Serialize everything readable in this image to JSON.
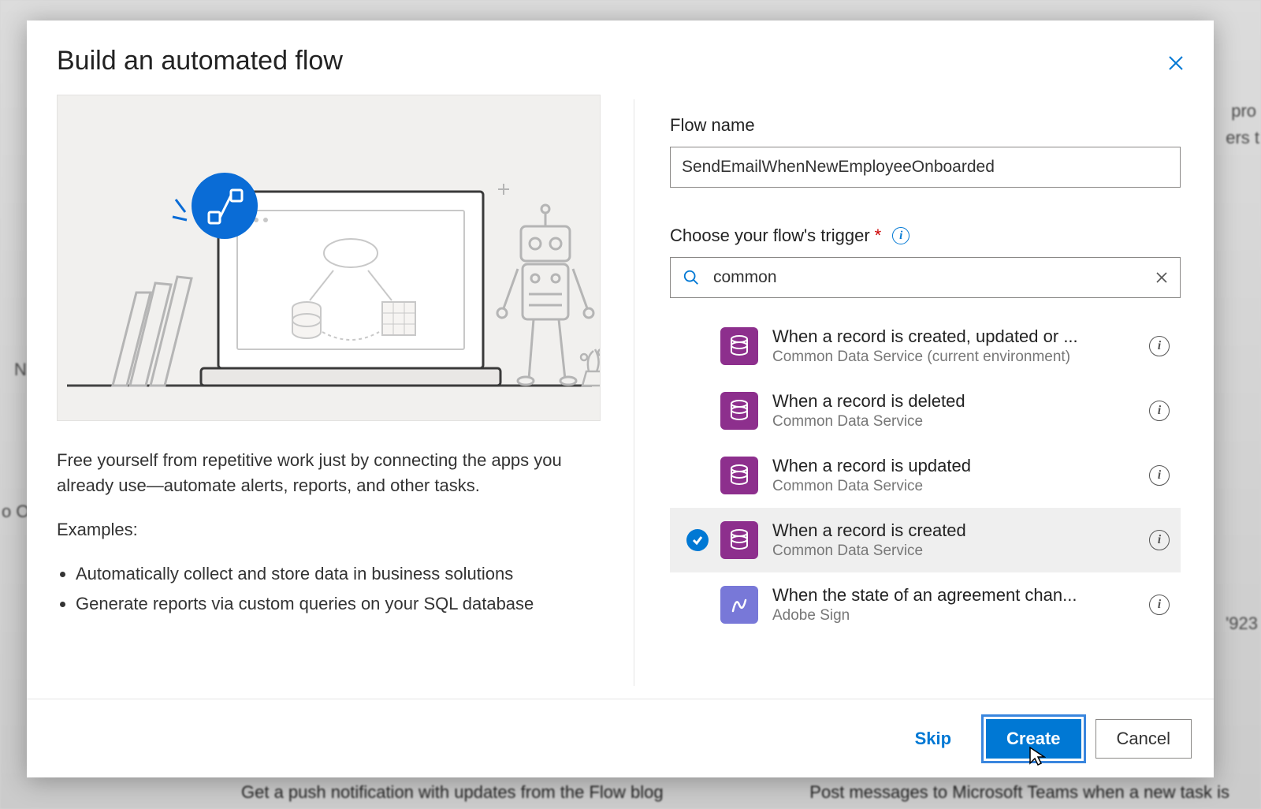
{
  "dialog": {
    "title": "Build an automated flow",
    "close_label": "Close"
  },
  "left": {
    "description": "Free yourself from repetitive work just by connecting the apps you already use—automate alerts, reports, and other tasks.",
    "examples_heading": "Examples:",
    "examples": [
      "Automatically collect and store data in business solutions",
      "Generate reports via custom queries on your SQL database"
    ]
  },
  "right": {
    "flow_name_label": "Flow name",
    "flow_name_value": "SendEmailWhenNewEmployeeOnboarded",
    "trigger_label": "Choose your flow's trigger",
    "search_value": "common",
    "triggers": [
      {
        "title": "When a record is created, updated or ...",
        "sub": "Common Data Service (current environment)",
        "connector": "cds",
        "selected": false
      },
      {
        "title": "When a record is deleted",
        "sub": "Common Data Service",
        "connector": "cds",
        "selected": false
      },
      {
        "title": "When a record is updated",
        "sub": "Common Data Service",
        "connector": "cds",
        "selected": false
      },
      {
        "title": "When a record is created",
        "sub": "Common Data Service",
        "connector": "cds",
        "selected": true
      },
      {
        "title": "When the state of an agreement chan...",
        "sub": "Adobe Sign",
        "connector": "adobe",
        "selected": false
      }
    ]
  },
  "footer": {
    "skip": "Skip",
    "create": "Create",
    "cancel": "Cancel"
  },
  "colors": {
    "primary_blue": "#0078d4",
    "cds_purple": "#8d2f8d",
    "adobe_blue": "#7878d8"
  },
  "background_fragments": {
    "top_right1": "pro",
    "top_right2": "ers t",
    "left_mid": "o On",
    "right_mid": "'923",
    "bottom_left": "Get a push notification with updates from the Flow blog",
    "bottom_right": "Post messages to Microsoft Teams when a new task is",
    "left_top": "N"
  }
}
